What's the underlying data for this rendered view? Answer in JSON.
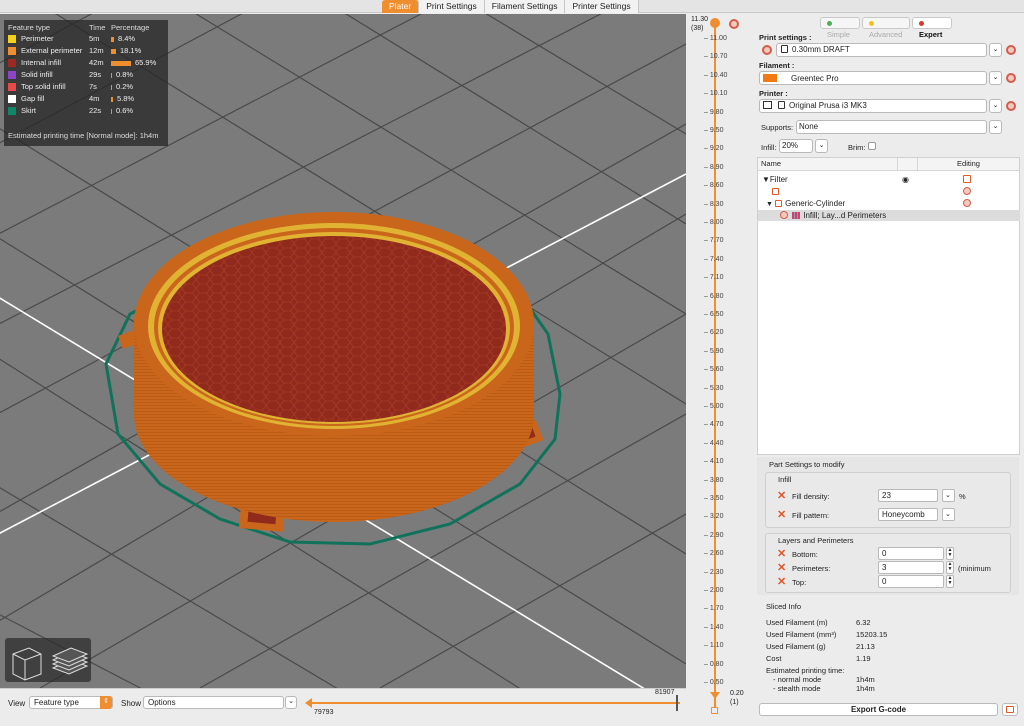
{
  "tabs": [
    {
      "label": "Plater",
      "active": true
    },
    {
      "label": "Print Settings",
      "active": false
    },
    {
      "label": "Filament Settings",
      "active": false
    },
    {
      "label": "Printer Settings",
      "active": false
    }
  ],
  "legend": {
    "headers": {
      "feature": "Feature type",
      "time": "Time",
      "percentage": "Percentage"
    },
    "rows": [
      {
        "name": "Perimeter",
        "time": "5m",
        "pct": "8.4%",
        "color": "#f2d21b",
        "share": 8.4
      },
      {
        "name": "External perimeter",
        "time": "12m",
        "pct": "18.1%",
        "color": "#f08d2e",
        "share": 18.1
      },
      {
        "name": "Internal infill",
        "time": "42m",
        "pct": "65.9%",
        "color": "#9b2a22",
        "share": 65.9
      },
      {
        "name": "Solid infill",
        "time": "29s",
        "pct": "0.8%",
        "color": "#8e44c9",
        "share": 0.8
      },
      {
        "name": "Top solid infill",
        "time": "7s",
        "pct": "0.2%",
        "color": "#e84a4a",
        "share": 0.2
      },
      {
        "name": "Gap fill",
        "time": "4m",
        "pct": "5.8%",
        "color": "#ffffff",
        "share": 5.8
      },
      {
        "name": "Skirt",
        "time": "22s",
        "pct": "0.6%",
        "color": "#10876a",
        "share": 0.6
      }
    ],
    "estimate": "Estimated printing time [Normal mode]:   1h4m"
  },
  "bottom": {
    "view_label": "View",
    "view_value": "Feature type",
    "show_label": "Show",
    "show_value": "Options",
    "h_slider_max": "81907",
    "h_slider_min": "79793"
  },
  "vslider": {
    "top_value": "11.30",
    "top_layer": "(38)",
    "bottom_value": "0.20",
    "bottom_layer": "(1)",
    "ticks": [
      "11.00",
      "10.70",
      "10.40",
      "10.10",
      "9.80",
      "9.50",
      "9.20",
      "8.90",
      "8.60",
      "8.30",
      "8.00",
      "7.70",
      "7.40",
      "7.10",
      "6.80",
      "6.50",
      "6.20",
      "5.90",
      "5.60",
      "5.30",
      "5.00",
      "4.70",
      "4.40",
      "4.10",
      "3.80",
      "3.50",
      "3.20",
      "2.90",
      "2.60",
      "2.30",
      "2.00",
      "1.70",
      "1.40",
      "1.10",
      "0.80",
      "0.50"
    ]
  },
  "panel": {
    "modes": [
      {
        "label": "Simple",
        "color": "#4caf50",
        "active": false
      },
      {
        "label": "Advanced",
        "color": "#f2c21b",
        "active": false
      },
      {
        "label": "Expert",
        "color": "#d63a2a",
        "active": true
      }
    ],
    "print_settings_label": "Print settings :",
    "print_settings_value": "0.30mm DRAFT",
    "filament_label": "Filament :",
    "filament_value": "Greentec Pro",
    "filament_color": "#f07b12",
    "printer_label": "Printer :",
    "printer_value": "Original Prusa i3 MK3",
    "supports_label": "Supports:",
    "supports_value": "None",
    "infill_label": "Infill:",
    "infill_value": "20%",
    "brim_label": "Brim:"
  },
  "objects": {
    "col_name": "Name",
    "col_editing": "Editing",
    "rows": [
      {
        "label": "▼Filter"
      },
      {
        "label": ""
      },
      {
        "label": "Generic-Cylinder"
      },
      {
        "label": "Infill; Lay...d Perimeters"
      }
    ]
  },
  "part_settings": {
    "title": "Part Settings to modify",
    "infill_group": "Infill",
    "fill_density_label": "Fill density:",
    "fill_density_value": "23",
    "fill_density_unit": "%",
    "fill_pattern_label": "Fill pattern:",
    "fill_pattern_value": "Honeycomb",
    "layers_group": "Layers and Perimeters",
    "bottom_label": "Bottom:",
    "bottom_value": "0",
    "perimeters_label": "Perimeters:",
    "perimeters_value": "3",
    "perimeters_note": "(minimum",
    "top_label": "Top:",
    "top_value": "0"
  },
  "sliced_info": {
    "title": "Sliced Info",
    "rows": [
      {
        "label": "Used Filament (m)",
        "value": "6.32"
      },
      {
        "label": "Used Filament (mm³)",
        "value": "15203.15"
      },
      {
        "label": "Used Filament (g)",
        "value": "21.13"
      },
      {
        "label": "Cost",
        "value": "1.19"
      }
    ],
    "time_label": "Estimated printing time:",
    "normal_label": "- normal mode",
    "normal_value": "1h4m",
    "stealth_label": "- stealth mode",
    "stealth_value": "1h4m"
  },
  "export_label": "Export G-code",
  "colors": {
    "accent": "#f08d2e",
    "model": "#c9661b",
    "infill": "#8f2a1c",
    "skirt": "#10725a"
  }
}
